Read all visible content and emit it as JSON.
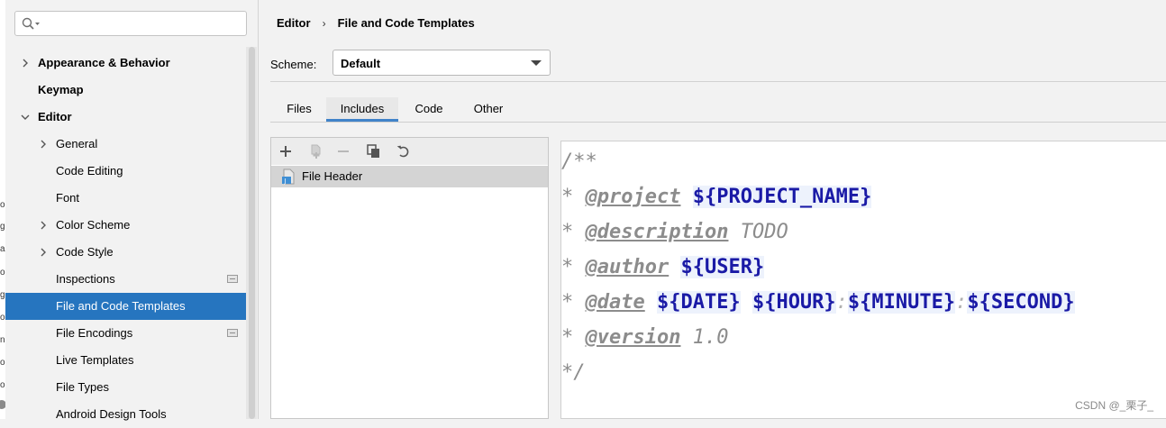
{
  "left_edge_chars": [
    "or",
    "g",
    "a",
    "o",
    "ge",
    "or",
    "n",
    "o",
    "o"
  ],
  "search": {
    "placeholder": ""
  },
  "sidebar": {
    "items": [
      {
        "label": "Appearance & Behavior",
        "bold": true,
        "chevron": "right"
      },
      {
        "label": "Keymap",
        "bold": true,
        "chevron": ""
      },
      {
        "label": "Editor",
        "bold": true,
        "chevron": "down"
      },
      {
        "label": "General",
        "bold": false,
        "chevron": "right"
      },
      {
        "label": "Code Editing",
        "bold": false,
        "chevron": ""
      },
      {
        "label": "Font",
        "bold": false,
        "chevron": ""
      },
      {
        "label": "Color Scheme",
        "bold": false,
        "chevron": "right"
      },
      {
        "label": "Code Style",
        "bold": false,
        "chevron": "right"
      },
      {
        "label": "Inspections",
        "bold": false,
        "chevron": "",
        "project_icon": true
      },
      {
        "label": "File and Code Templates",
        "bold": false,
        "chevron": "",
        "selected": true
      },
      {
        "label": "File Encodings",
        "bold": false,
        "chevron": "",
        "project_icon": true
      },
      {
        "label": "Live Templates",
        "bold": false,
        "chevron": ""
      },
      {
        "label": "File Types",
        "bold": false,
        "chevron": ""
      },
      {
        "label": "Android Design Tools",
        "bold": false,
        "chevron": ""
      }
    ]
  },
  "breadcrumb": {
    "parent": "Editor",
    "separator": "›",
    "current": "File and Code Templates"
  },
  "scheme": {
    "label": "Scheme:",
    "value": "Default"
  },
  "tabs": [
    "Files",
    "Includes",
    "Code",
    "Other"
  ],
  "active_tab": "Includes",
  "list": {
    "toolbar": [
      "add-icon",
      "copy-template-icon",
      "remove-icon",
      "duplicate-icon",
      "reset-icon"
    ],
    "items": [
      {
        "label": "File Header",
        "selected": true
      }
    ]
  },
  "editor": {
    "open": "/**",
    "star": "*",
    "close": "*/",
    "project_tag": "@project",
    "project_var": "${PROJECT_NAME}",
    "description_tag": "@description",
    "description_value": "TODO",
    "author_tag": "@author",
    "author_var": "${USER}",
    "date_tag": "@date",
    "date_var": "${DATE}",
    "hour_var": "${HOUR}",
    "minute_var": "${MINUTE}",
    "second_var": "${SECOND}",
    "colon": ":",
    "version_tag": "@version",
    "version_value": "1.0"
  },
  "watermark": "CSDN @_栗子_",
  "colors": {
    "selection": "#2675bf",
    "variable": "#1a1aa6",
    "comment": "#8c8c8c",
    "tab_underline": "#4083c9"
  }
}
